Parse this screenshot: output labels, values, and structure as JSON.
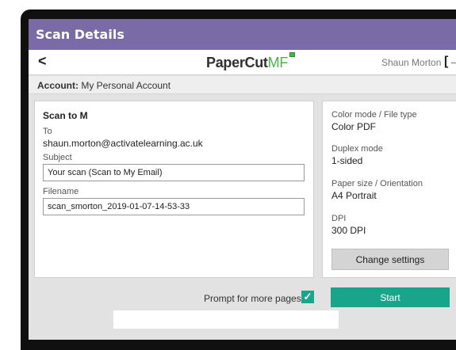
{
  "window": {
    "title": "Scan Details"
  },
  "header": {
    "back_icon": "chevron-left",
    "back_glyph": "<",
    "logo_main": "PaperCut",
    "logo_accent": "MF",
    "user_name": "Shaun Morton",
    "logout_icon": "logout-icon",
    "logout_glyph": "[→"
  },
  "account": {
    "label": "Account:",
    "value": "My Personal Account"
  },
  "scan": {
    "title": "Scan to M",
    "to_label": "To",
    "to_value": "shaun.morton@activatelearning.ac.uk",
    "subject_label": "Subject",
    "subject_value": "Your scan (Scan to My Email)",
    "filename_label": "Filename",
    "filename_value": "scan_smorton_2019-01-07-14-53-33"
  },
  "settings": {
    "color_label": "Color mode / File type",
    "color_value": "Color PDF",
    "duplex_label": "Duplex mode",
    "duplex_value": "1-sided",
    "paper_label": "Paper size / Orientation",
    "paper_value": "A4 Portrait",
    "dpi_label": "DPI",
    "dpi_value": "300 DPI",
    "change_label": "Change settings"
  },
  "footer": {
    "prompt_label": "Prompt for more pages",
    "prompt_checked": true,
    "check_glyph": "✓",
    "start_label": "Start"
  },
  "colors": {
    "titlebar": "#7a6aa5",
    "accent": "#18a58b",
    "logo_green": "#4ab34a"
  }
}
